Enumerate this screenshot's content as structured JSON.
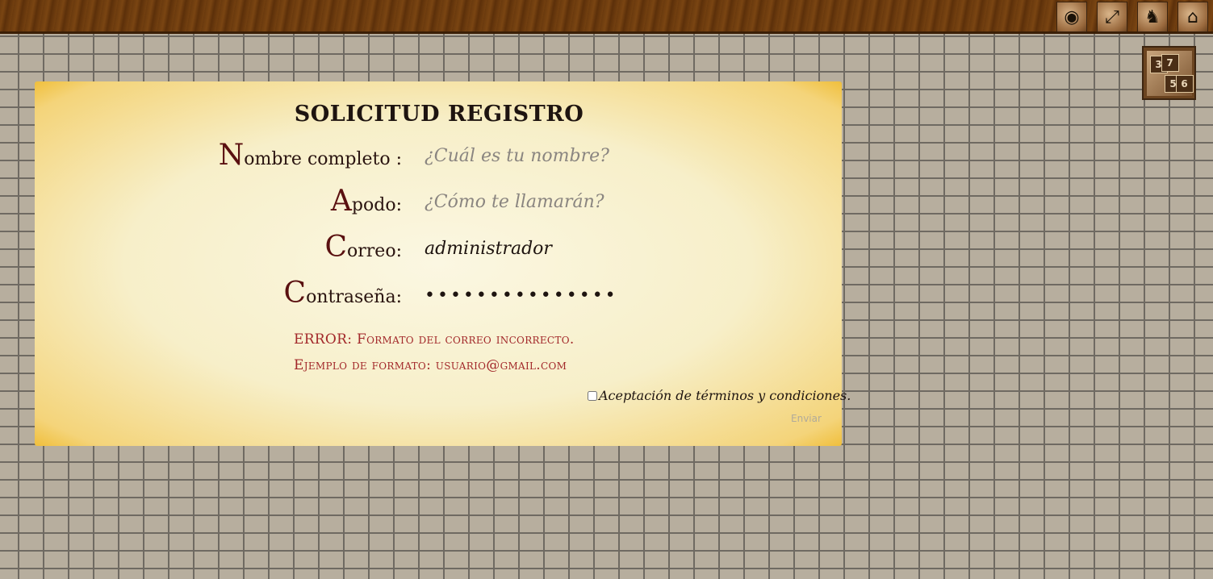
{
  "form": {
    "title": "SOLICITUD REGISTRO",
    "fields": [
      {
        "label_cap": "N",
        "label_rest": "ombre completo :",
        "placeholder": "¿Cuál es tu nombre?",
        "value": ""
      },
      {
        "label_cap": "A",
        "label_rest": "podo:",
        "placeholder": "¿Cómo te llamarán?",
        "value": ""
      },
      {
        "label_cap": "C",
        "label_rest": "orreo:",
        "placeholder": "",
        "value": "administrador"
      },
      {
        "label_cap": "C",
        "label_rest": "ontraseña:",
        "placeholder": "",
        "value": "•••••••••••••••"
      }
    ],
    "error_line1": "ERROR: Formato del correo incorrecto.",
    "error_line2": "Ejemplo de formato: usuario@gmail.com",
    "terms_label": "Aceptación de términos y condiciones.",
    "submit_label": "Enviar"
  },
  "topbar": {
    "icons": [
      "eye-icon",
      "fullscreen-icon",
      "knight-helmet-icon",
      "home-icon"
    ]
  },
  "dice": {
    "icon": "dice-icon",
    "faces": [
      "3",
      "7",
      "5",
      "6"
    ]
  }
}
